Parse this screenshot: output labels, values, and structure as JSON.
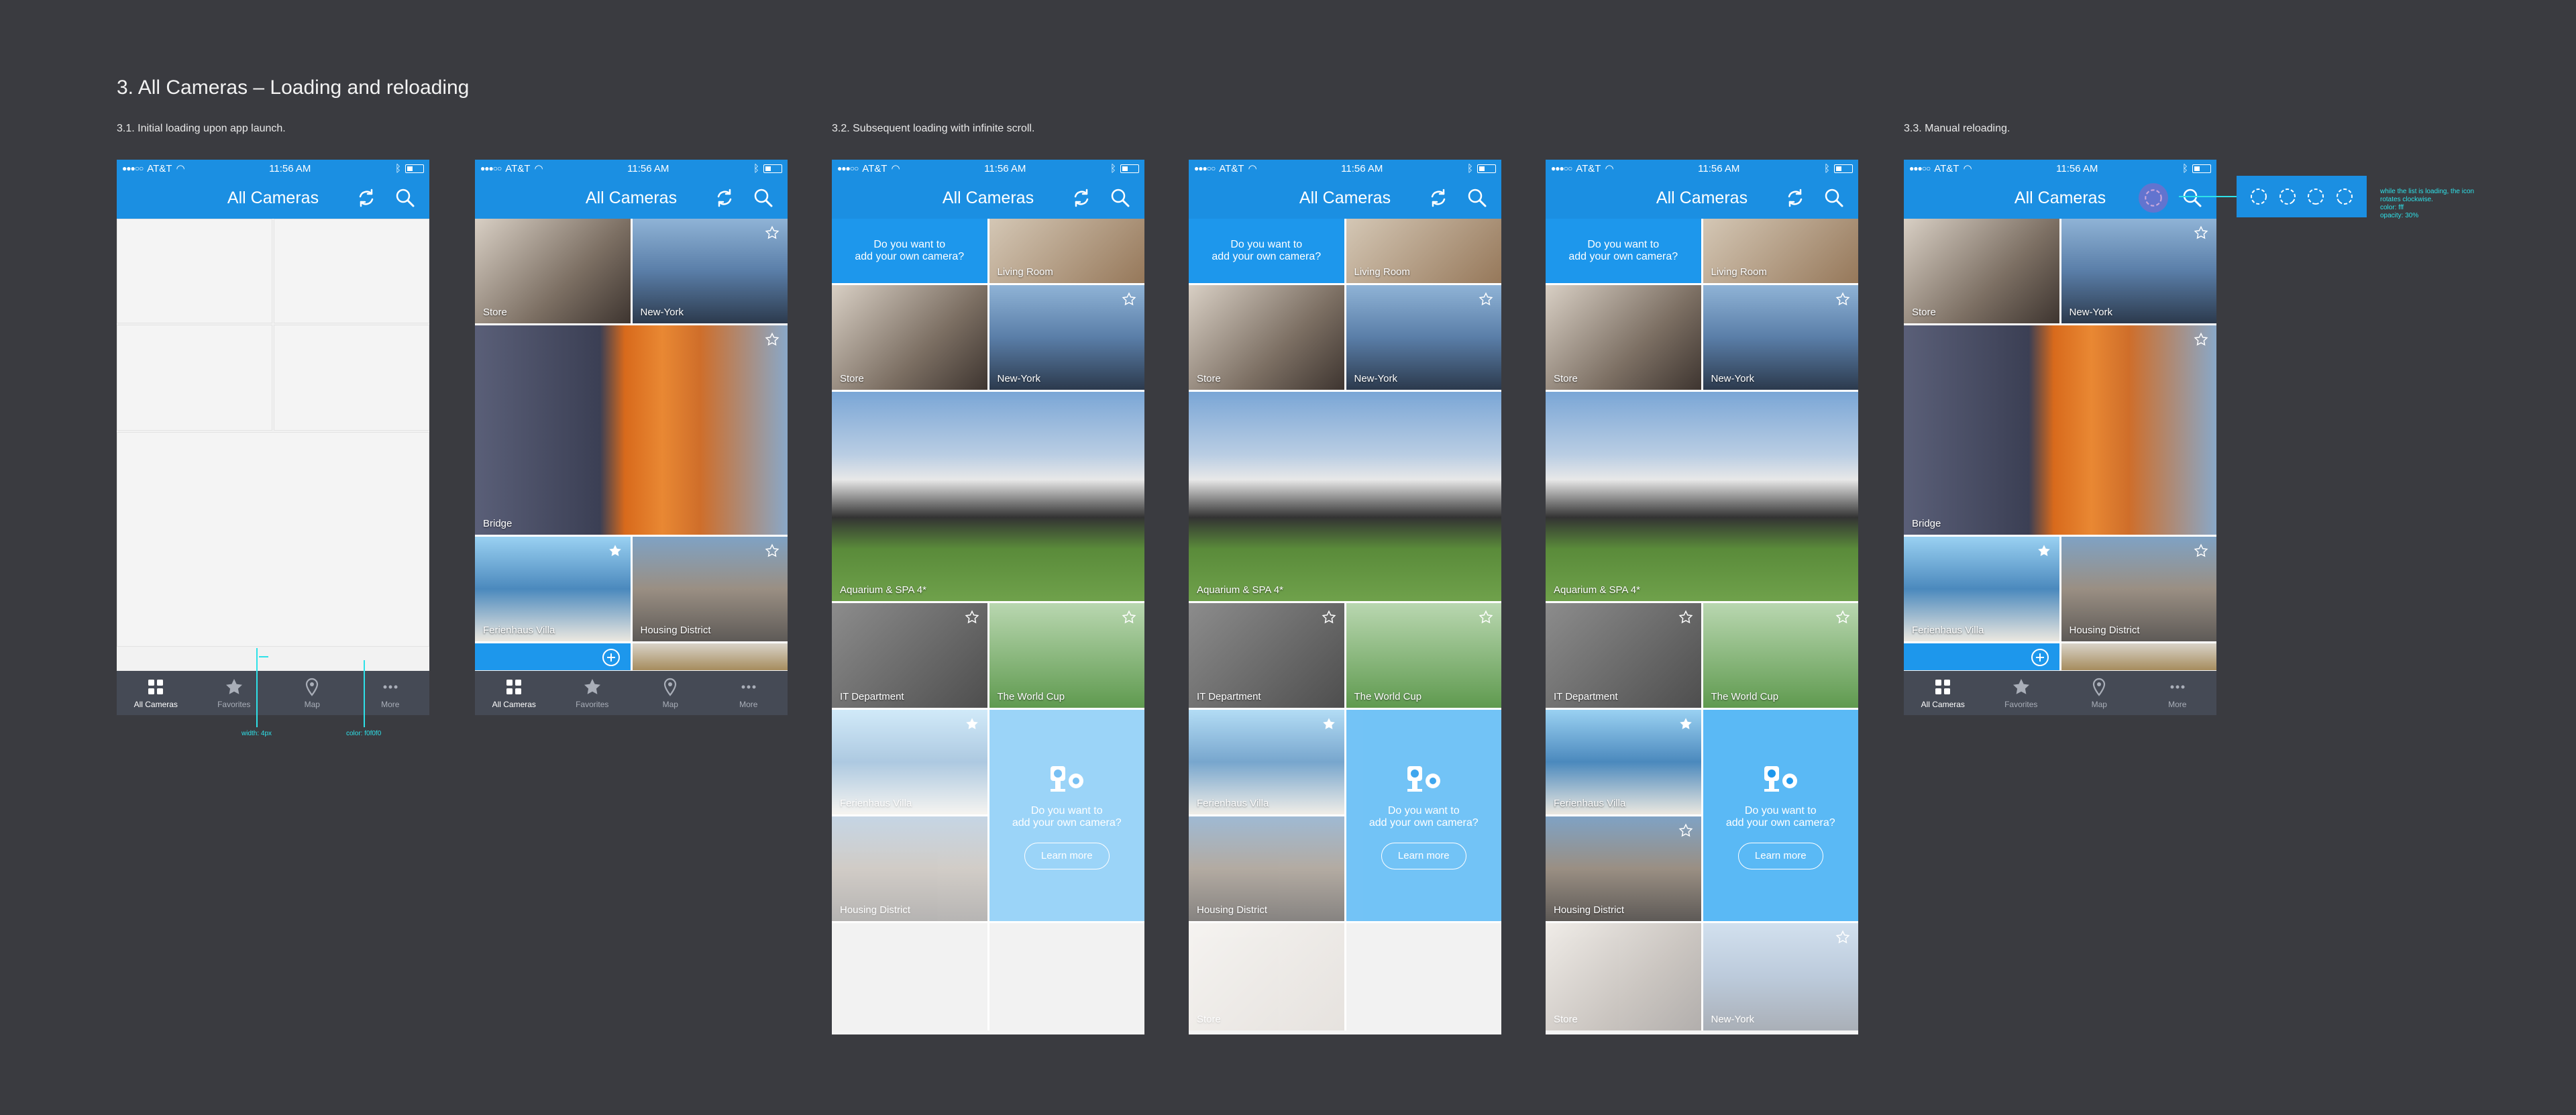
{
  "heading": "3. All Cameras – Loading and reloading",
  "sections": {
    "s1": "3.1. Initial loading upon app launch.",
    "s2": "3.2. Subsequent loading with infinite scroll.",
    "s3": "3.3. Manual reloading."
  },
  "status": {
    "carrier": "AT&T",
    "time": "11:56 AM"
  },
  "nav_title": "All Cameras",
  "tabs": [
    "All Cameras",
    "Favorites",
    "Map",
    "More"
  ],
  "cameras": {
    "store": "Store",
    "newyork": "New-York",
    "bridge": "Bridge",
    "ferienhaus": "Ferienhaus Villa",
    "housing": "Housing District",
    "living": "Living Room",
    "aquarium": "Aquarium & SPA 4*",
    "it": "IT Department",
    "worldcup": "The World Cup"
  },
  "promo": {
    "line1": "Do you want to",
    "line2": "add your own camera?",
    "button": "Learn more"
  },
  "annotations": {
    "width": "width: 4px",
    "color": "color: f0f0f0",
    "spin_note": [
      "while the list is loading, the icon",
      "rotates clockwise.",
      "color: fff",
      "opacity: 30%"
    ]
  },
  "colors": {
    "brand": "#1b8fe2",
    "tabbar": "#454a55",
    "annotation": "#2ee1e8"
  }
}
